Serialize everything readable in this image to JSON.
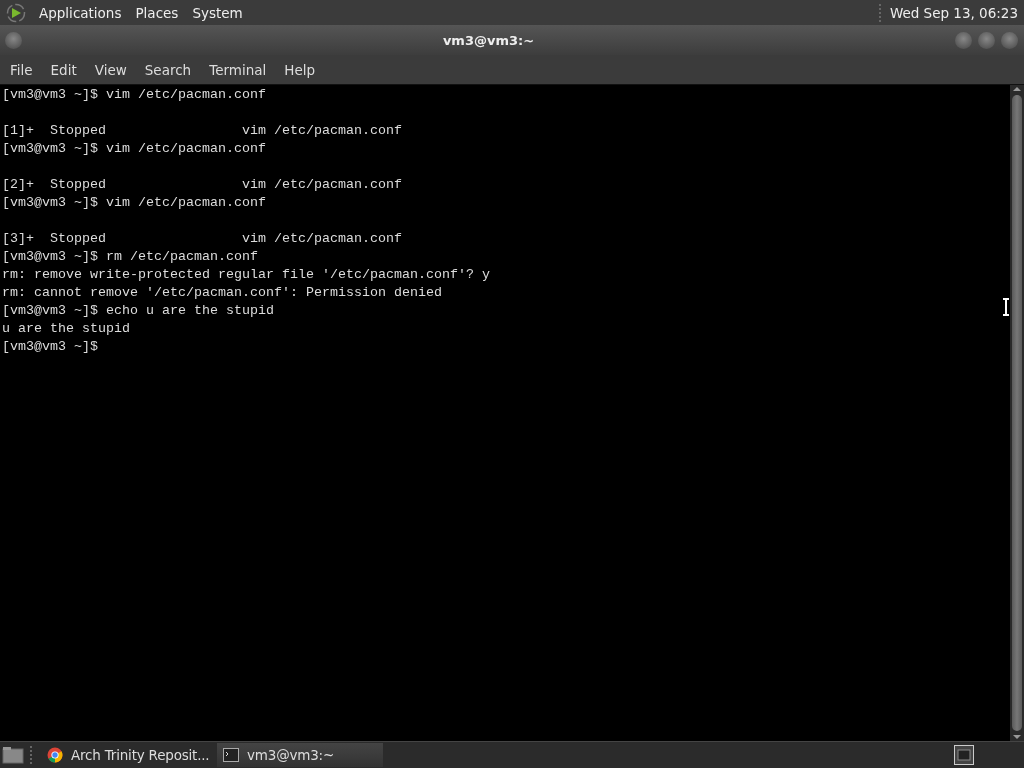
{
  "top_panel": {
    "menus": [
      "Applications",
      "Places",
      "System"
    ],
    "clock": "Wed Sep 13, 06:23"
  },
  "window": {
    "title": "vm3@vm3:~"
  },
  "menu_bar": [
    "File",
    "Edit",
    "View",
    "Search",
    "Terminal",
    "Help"
  ],
  "terminal": {
    "lines": [
      {
        "kind": "text",
        "text": "[vm3@vm3 ~]$ vim /etc/pacman.conf"
      },
      {
        "kind": "blank"
      },
      {
        "kind": "text",
        "text": "[1]+  Stopped                 vim /etc/pacman.conf"
      },
      {
        "kind": "text",
        "text": "[vm3@vm3 ~]$ vim /etc/pacman.conf"
      },
      {
        "kind": "blank"
      },
      {
        "kind": "text",
        "text": "[2]+  Stopped                 vim /etc/pacman.conf"
      },
      {
        "kind": "text",
        "text": "[vm3@vm3 ~]$ vim /etc/pacman.conf"
      },
      {
        "kind": "blank"
      },
      {
        "kind": "text",
        "text": "[3]+  Stopped                 vim /etc/pacman.conf"
      },
      {
        "kind": "text",
        "text": "[vm3@vm3 ~]$ rm /etc/pacman.conf"
      },
      {
        "kind": "text",
        "text": "rm: remove write-protected regular file '/etc/pacman.conf'? y"
      },
      {
        "kind": "text",
        "text": "rm: cannot remove '/etc/pacman.conf': Permission denied"
      },
      {
        "kind": "text",
        "text": "[vm3@vm3 ~]$ echo u are the stupid"
      },
      {
        "kind": "text",
        "text": "u are the stupid"
      },
      {
        "kind": "text",
        "text": "[vm3@vm3 ~]$"
      }
    ]
  },
  "taskbar": {
    "tasks": [
      {
        "kind": "browser",
        "label": "Arch Trinity Reposit...",
        "selected": false
      },
      {
        "kind": "terminal",
        "label": "vm3@vm3:~",
        "selected": true
      }
    ]
  }
}
